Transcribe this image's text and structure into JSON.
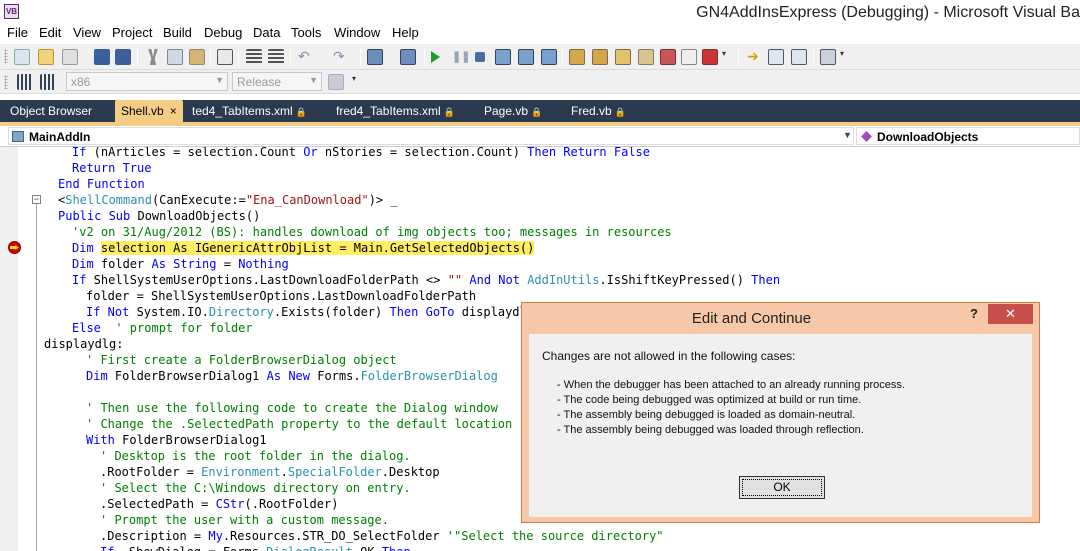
{
  "window": {
    "title": "GN4AddInsExpress (Debugging) - Microsoft Visual Ba",
    "icon_label": "VB"
  },
  "menu": [
    "File",
    "Edit",
    "View",
    "Project",
    "Build",
    "Debug",
    "Data",
    "Tools",
    "Window",
    "Help"
  ],
  "toolbar2": {
    "platform": "x86",
    "configuration": "Release"
  },
  "tabs": [
    {
      "label": "Object Browser",
      "active": false,
      "pinned": false
    },
    {
      "label": "Shell.vb",
      "active": true,
      "pinned": false
    },
    {
      "label": "ted4_TabItems.xml",
      "active": false,
      "pinned": true
    },
    {
      "label": "fred4_TabItems.xml",
      "active": false,
      "pinned": true
    },
    {
      "label": "Page.vb",
      "active": false,
      "pinned": true
    },
    {
      "label": "Fred.vb",
      "active": false,
      "pinned": true
    }
  ],
  "tab_close_glyph": "×",
  "tab_pin_glyph": "🔒",
  "nav": {
    "class_name": "MainAddIn",
    "member_name": "DownloadObjects"
  },
  "code": {
    "line1": "If (nArticles = selection.Count Or nStories = selection.Count) Then Return False",
    "line2": "Return True",
    "line3": "End Function",
    "attr_open": "<",
    "attr_name": "ShellCommand",
    "attr_args": "(CanExecute:=",
    "attr_str": "\"Ena_CanDownload\"",
    "attr_close": ")> _",
    "line5": "Public Sub DownloadObjects()",
    "comment1": "'v2 on 31/Aug/2012 (BS): handles download of img objects too; messages in resources",
    "dim1_kw": "Dim ",
    "dim1_hl": "selection As IGenericAttrObjList = Main.GetSelectedObjects()",
    "dim2": "Dim folder As String = Nothing",
    "if1": "If ShellSystemUserOptions.LastDownloadFolderPath <> \"\" And Not AddInUtils.IsShiftKeyPressed() Then",
    "folder_assign": "folder = ShellSystemUserOptions.LastDownloadFolderPath",
    "if2": "If Not System.IO.Directory.Exists(folder) Then GoTo displaydlg",
    "else": "Else  ' prompt for folder",
    "label": "displaydlg:",
    "c_first": "' First create a FolderBrowserDialog object",
    "dim3": "Dim FolderBrowserDialog1 As New Forms.FolderBrowserDialog",
    "c_then": "' Then use the following code to create the Dialog window",
    "c_change": "' Change the .SelectedPath property to the default location",
    "with": "With FolderBrowserDialog1",
    "c_desktop": "' Desktop is the root folder in the dialog.",
    "rootfolder": ".RootFolder = Environment.SpecialFolder.Desktop",
    "c_select": "' Select the C:\\Windows directory on entry.",
    "selectedpath": ".SelectedPath = CStr(.RootFolder)",
    "c_prompt": "' Prompt the user with a custom message.",
    "description": ".Description = My.Resources.STR_DO_SelectFolder '\"Select the source directory\"",
    "ifshow": "If .ShowDialog = Forms.DialogResult.OK Then"
  },
  "dialog": {
    "title": "Edit and Continue",
    "help_glyph": "?",
    "close_glyph": "✕",
    "message": "Changes are not allowed in the following cases:",
    "cases": [
      "- When the debugger has been attached to an already running process.",
      "- The code being debugged was optimized at build or run time.",
      "- The assembly being debugged is loaded as domain-neutral.",
      "- The assembly being debugged was loaded through reflection."
    ],
    "ok_label": "OK"
  },
  "colors": {
    "keyword": "#0000ff",
    "type": "#2b91af",
    "string": "#a31515",
    "comment": "#008000",
    "highlight": "#ffee62",
    "tab_active": "#f5cc84",
    "tabstrip": "#2b3a4f",
    "dialog_frame": "#f6c8a8",
    "dialog_close": "#c7504c"
  }
}
